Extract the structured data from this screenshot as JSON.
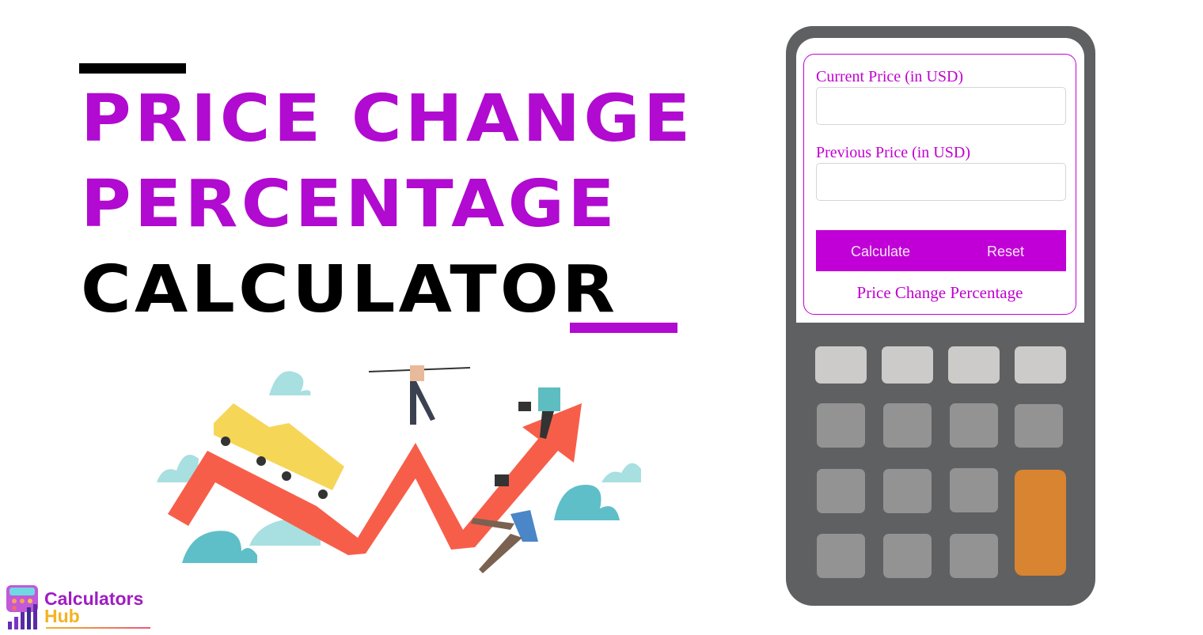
{
  "hero": {
    "title_line1": "PRICE CHANGE",
    "title_line2": "PERCENTAGE",
    "title_line3": "CALCULATOR",
    "accent_color": "#b10ad0",
    "illustration": "chart-arrow-businesspeople-illustration"
  },
  "calculator": {
    "fields": [
      {
        "label": "Current Price (in USD)",
        "value": "",
        "placeholder": ""
      },
      {
        "label": "Previous Price (in USD)",
        "value": "",
        "placeholder": ""
      }
    ],
    "buttons": {
      "calculate": "Calculate",
      "reset": "Reset"
    },
    "result_label": "Price Change Percentage",
    "brand_color": "#c000d6",
    "keypad": {
      "rows": 4,
      "cols": 4,
      "equals_key_color": "#d98430"
    }
  },
  "brand": {
    "line1": "Calculators",
    "line2": "Hub",
    "icon": "calculator-bars-logo-icon"
  }
}
